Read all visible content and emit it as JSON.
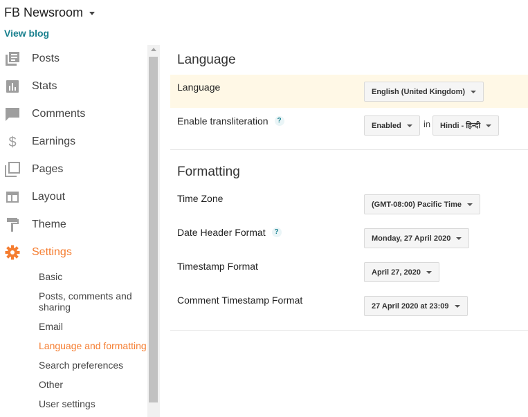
{
  "header": {
    "blog_title": "FB Newsroom",
    "view_blog": "View blog"
  },
  "sidebar": {
    "items": [
      {
        "label": "Posts",
        "icon": "posts-icon"
      },
      {
        "label": "Stats",
        "icon": "stats-icon"
      },
      {
        "label": "Comments",
        "icon": "comments-icon"
      },
      {
        "label": "Earnings",
        "icon": "dollar-icon"
      },
      {
        "label": "Pages",
        "icon": "pages-icon"
      },
      {
        "label": "Layout",
        "icon": "layout-icon"
      },
      {
        "label": "Theme",
        "icon": "paint-roller-icon"
      },
      {
        "label": "Settings",
        "icon": "gear-icon"
      }
    ],
    "settings_sub": [
      "Basic",
      "Posts, comments and sharing",
      "Email",
      "Language and formatting",
      "Search preferences",
      "Other",
      "User settings"
    ],
    "active_item": "Settings",
    "active_sub": "Language and formatting"
  },
  "language": {
    "title": "Language",
    "language_label": "Language",
    "language_value": "English (United Kingdom)",
    "translit_label": "Enable transliteration",
    "translit_help": "?",
    "translit_value": "Enabled",
    "in_word": "in",
    "translit_lang": "Hindi - हिन्दी"
  },
  "formatting": {
    "title": "Formatting",
    "timezone_label": "Time Zone",
    "timezone_value": "(GMT-08:00) Pacific Time",
    "date_header_label": "Date Header Format",
    "date_header_help": "?",
    "date_header_value": "Monday, 27 April 2020",
    "timestamp_label": "Timestamp Format",
    "timestamp_value": "April 27, 2020",
    "comment_ts_label": "Comment Timestamp Format",
    "comment_ts_value": "27 April 2020 at 23:09"
  },
  "colors": {
    "accent": "#f57d30",
    "link": "#19808e",
    "icon_gray": "#9e9e9e",
    "highlight_row": "#fff8e6"
  }
}
